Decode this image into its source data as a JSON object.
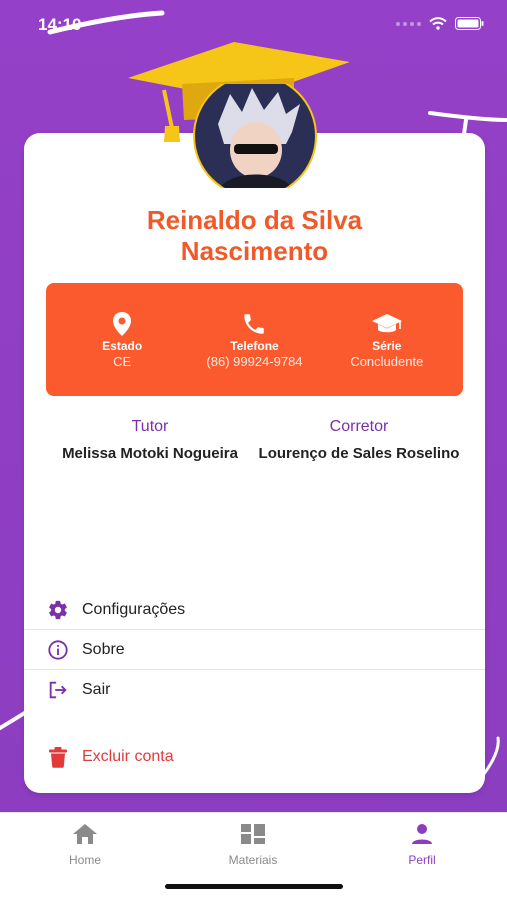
{
  "status_bar": {
    "time": "14:10"
  },
  "profile": {
    "name": "Reinaldo da Silva Nascimento",
    "avatar_alt": "avatar"
  },
  "info": [
    {
      "icon": "location-pin-icon",
      "label": "Estado",
      "value": "CE"
    },
    {
      "icon": "phone-icon",
      "label": "Telefone",
      "value": "(86) 99924-9784"
    },
    {
      "icon": "graduation-cap-icon",
      "label": "Série",
      "value": "Concludente"
    }
  ],
  "people": [
    {
      "role": "Tutor",
      "name": "Melissa Motoki Nogueira"
    },
    {
      "role": "Corretor",
      "name": "Lourenço de Sales Roselino"
    }
  ],
  "menu": [
    {
      "icon": "gear-icon",
      "label": "Configurações"
    },
    {
      "icon": "info-icon",
      "label": "Sobre"
    },
    {
      "icon": "logout-icon",
      "label": "Sair"
    }
  ],
  "delete_account": {
    "icon": "trash-icon",
    "label": "Excluir conta"
  },
  "tabs": [
    {
      "icon": "home-icon",
      "label": "Home",
      "active": false
    },
    {
      "icon": "grid-icon",
      "label": "Materiais",
      "active": false
    },
    {
      "icon": "person-icon",
      "label": "Perfil",
      "active": true
    }
  ],
  "colors": {
    "background": "#8e3fc0",
    "accent_orange": "#fb5a2e",
    "name_orange": "#f05a2a",
    "purple": "#8b3dbf",
    "cap_yellow": "#f5c518",
    "delete_red": "#e23a3a"
  }
}
